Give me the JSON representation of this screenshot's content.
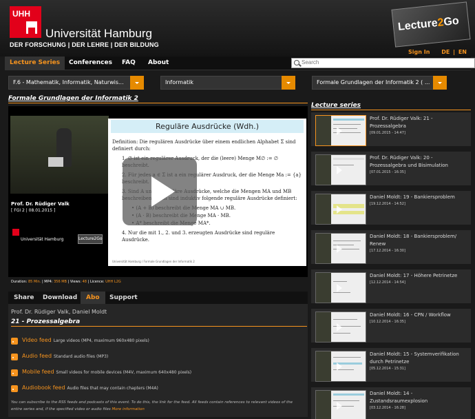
{
  "header": {
    "logo_abbr": "UHH",
    "logo_name": "Universität Hamburg",
    "tagline": "DER FORSCHUNG | DER LEHRE | DER BILDUNG",
    "lecture2go": {
      "a": "Lecture",
      "b": "2",
      "c": "Go"
    },
    "signin": "Sign In",
    "lang_de": "DE",
    "lang_sep": "|",
    "lang_en": "EN"
  },
  "nav": {
    "items": [
      "Lecture Series",
      "Conferences",
      "FAQ",
      "About"
    ],
    "active": "Lecture Series",
    "search_placeholder": "Search"
  },
  "filters": [
    "F.6 - Mathematik, Informatik, Naturwis...",
    "Informatik",
    "Formale Grundlagen der Informatik 2 ( ..."
  ],
  "event_title": "Formale Grundlagen der Informatik 2",
  "series_heading": "Lecture series",
  "player": {
    "presenter": "Prof. Dr. Rüdiger Valk",
    "presenter_sub": "[ FGI 2 | 08.01.2015 ]",
    "mini_logo": "Universität Hamburg",
    "mini_l2g": "Lecture2Go",
    "slide_title": "Reguläre Ausdrücke (Wdh.)",
    "slide_def": "Definition: Die regulären Ausdrücke über einem endlichen Alphabet Σ sind definiert durch:",
    "slide_items": [
      "1. ∅ ist ein regulärer Ausdruck, der die (leere) Menge M∅ := ∅ beschreibt.",
      "2. Für jedes a ∈ Σ ist a ein regulärer Ausdruck, der die Menge Ma := {a} beschreibt.",
      "3. Sind A und B reguläre Ausdrücke, welche die Mengen MA und MB beschreiben, dann sind induktiv folgende reguläre Ausdrücke definiert:",
      "• (A + B) beschreibt die Menge MA ∪ MB.",
      "• (A · B) beschreibt die Menge MA · MB.",
      "• A* beschreibt die Menge MA*.",
      "4. Nur die mit 1., 2. und 3. erzeugten Ausdrücke sind reguläre Ausdrücke."
    ],
    "slide_footer": "Universität Hamburg / Formale Grundlagen der Informatik 2"
  },
  "meta": {
    "duration_label": "Duration:",
    "duration": "85 Min.",
    "mp4_label": "MP4:",
    "mp4": "356 MB",
    "views_label": "Views:",
    "views": "48",
    "licence_label": "Licence:",
    "licence": "UHH L2G"
  },
  "tabs": [
    "Share",
    "Download",
    "Abo",
    "Support"
  ],
  "active_tab": "Abo",
  "abo": {
    "authors": "Prof. Dr. Rüdiger Valk, Daniel Moldt",
    "talk_title": "21 - Prozessalgebra",
    "feeds": [
      {
        "label": "Video feed",
        "desc": "Large videos (MP4, maximum 960x480 pixels)"
      },
      {
        "label": "Audio feed",
        "desc": "Standard audio files (MP3)"
      },
      {
        "label": "Mobile feed",
        "desc": "Small videos for mobile devices (M4V, maximum 640x480 pixels)"
      },
      {
        "label": "Audiobook feed",
        "desc": "Audio files that may contain chapters (M4A)"
      }
    ],
    "note": "You can subscribe to the RSS feeds and podcasts of this event. To do this, the link for the feed. All feeds contain references to relevant videos of the entire series and, if the specified video or audio files",
    "more": "More information"
  },
  "series_list": [
    {
      "title": "Prof. Dr. Rüdiger Valk: 21 - Prozessalgebra",
      "date": "[09.01.2015 - 14:47]"
    },
    {
      "title": "Prof. Dr. Rüdiger Valk: 20 - Prozessalgebra und Bisimulation",
      "date": "[07.01.2015 - 16:35]"
    },
    {
      "title": "Daniel Moldt: 19 - Bankiersproblem",
      "date": "[19.12.2014 - 14:52]"
    },
    {
      "title": "Daniel Moldt: 18 - Bankiersproblem/ Renew",
      "date": "[17.12.2014 - 16:30]"
    },
    {
      "title": "Daniel Moldt: 17 - Höhere Petrinetze",
      "date": "[12.12.2014 - 14:54]"
    },
    {
      "title": "Daniel Moldt: 16 - CPN / Workflow",
      "date": "[10.12.2014 - 16:35]"
    },
    {
      "title": "Daniel Moldt: 15 - Systemverifikation durch Petrinetze",
      "date": "[05.12.2014 - 15:31]"
    },
    {
      "title": "Daniel Moldt: 14 - Zustandsraumexplosion",
      "date": "[03.12.2014 - 16:28]"
    }
  ],
  "colors": {
    "accent": "#f7941e",
    "brand_red": "#e2001a",
    "background": "#1a1a1a"
  }
}
